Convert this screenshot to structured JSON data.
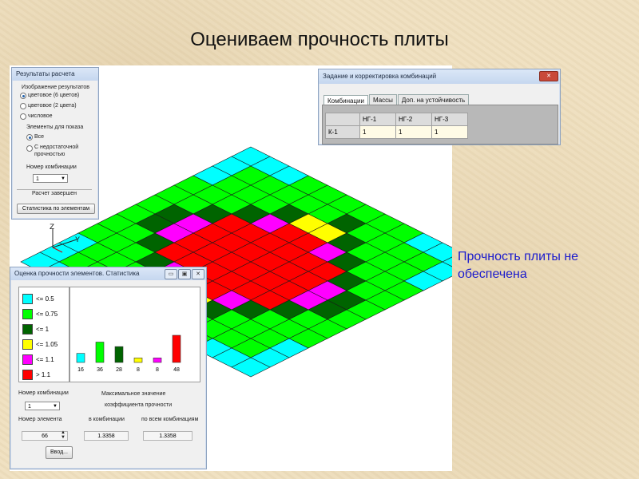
{
  "slide": {
    "title": "Оцениваем прочность плиты",
    "note": "Прочность плиты не обеспечена"
  },
  "results_window": {
    "title": "Результаты расчета",
    "image_label": "Изображение результатов",
    "options": [
      "цветовое (6 цветов)",
      "цветовое (2 цвета)",
      "числовое"
    ],
    "selected_option": 0,
    "elements_label": "Элементы для показа",
    "element_options": [
      "Все",
      "С недостаточной",
      "прочностью"
    ],
    "combo_label": "Номер комбинации",
    "combo_value": "1",
    "status": "Расчет завершен",
    "stats_button": "Статистика по элементам"
  },
  "combo_window": {
    "title": "Задание и корректировка комбинаций",
    "tabs": [
      "Комбинации",
      "Массы",
      "Доп. на устойчивость"
    ],
    "active_tab": 0,
    "headers": [
      "НГ-1",
      "НГ-2",
      "НГ-3"
    ],
    "rows": [
      {
        "label": "К-1",
        "values": [
          "1",
          "1",
          "1"
        ]
      }
    ]
  },
  "axes": {
    "z": "Z",
    "y": "Y"
  },
  "stats_window": {
    "title": "Оценка прочности элементов. Статистика",
    "combo_label": "Номер комбинации",
    "combo_value": "1",
    "max_label_1": "Максимальное значение",
    "max_label_2": "коэффициента прочности",
    "element_label": "Номер элемента",
    "element_value": "66",
    "in_combo_label": "в комбинации",
    "all_combos_label": "по всем комбинациям",
    "in_combo_value": "1.3358",
    "all_combos_value": "1.3358",
    "input_button": "Ввод..."
  },
  "legend": [
    {
      "label": "<= 0.5",
      "color": "#00ffff"
    },
    {
      "label": "<= 0.75",
      "color": "#00ff00"
    },
    {
      "label": "<= 1",
      "color": "#006400"
    },
    {
      "label": "<= 1.05",
      "color": "#ffff00"
    },
    {
      "label": "<= 1.1",
      "color": "#ff00ff"
    },
    {
      "label": ">  1.1",
      "color": "#ff0000"
    }
  ],
  "chart_data": {
    "type": "bar",
    "categories": [
      "<= 0.5",
      "<= 0.75",
      "<= 1",
      "<= 1.05",
      "<= 1.1",
      ">  1.1"
    ],
    "values": [
      16,
      36,
      28,
      8,
      8,
      48
    ],
    "value_labels": [
      "16",
      "36",
      "28",
      "8",
      "8",
      "48"
    ],
    "colors": [
      "#00ffff",
      "#00ff00",
      "#006400",
      "#ffff00",
      "#ff00ff",
      "#ff0000"
    ],
    "title": "",
    "xlabel": "",
    "ylabel": "",
    "ylim": [
      0,
      48
    ],
    "grid": false
  },
  "plate": {
    "colors": {
      "C": "#00ffff",
      "G": "#00ff00",
      "D": "#006400",
      "Y": "#ffff00",
      "M": "#ff00ff",
      "R": "#ff0000"
    },
    "cells": [
      "CCCGGGGGGCCC",
      "CGGGGGDGGGGC",
      "CGGGDYYDGGGC",
      "GGGDMRRMDGGG",
      "GGDRRRRRRDGG",
      "GDMRRRRRRMDG",
      "GDMRRRRRRMDG",
      "GGDRRRRRRDGG",
      "GGGDMRRMDGGG",
      "CGGGDYYDGGGC",
      "CGGGGGDGGGGC",
      "CCCGGGGGGCCC"
    ]
  }
}
